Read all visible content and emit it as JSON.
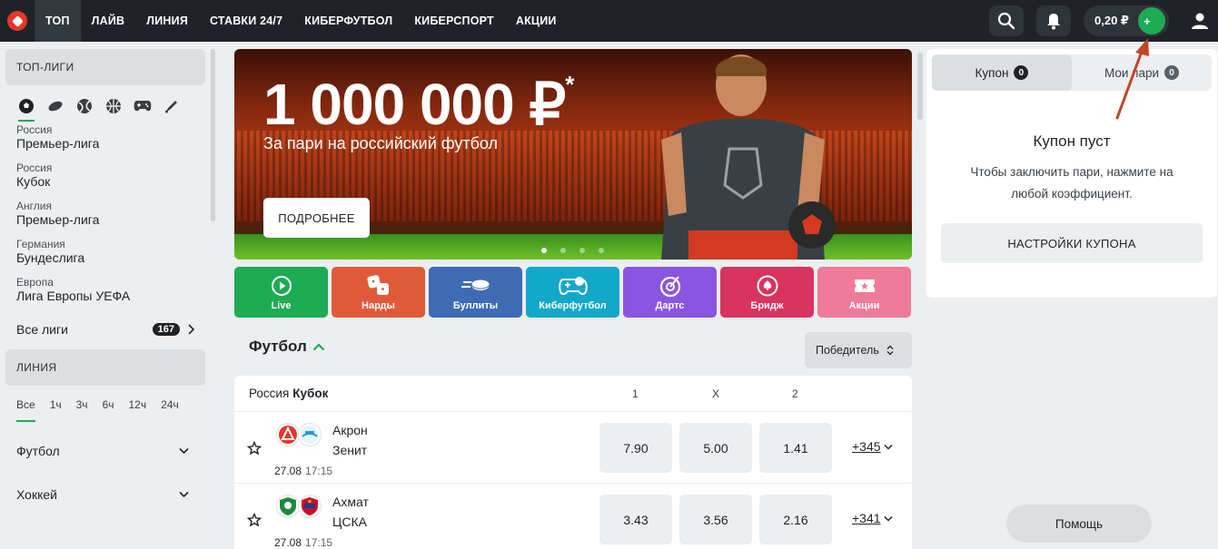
{
  "nav": {
    "items": [
      "ТОП",
      "ЛАЙВ",
      "ЛИНИЯ",
      "СТАВКИ 24/7",
      "КИБЕРФУТБОЛ",
      "КИБЕРСПОРТ",
      "АКЦИИ"
    ],
    "active_index": 0
  },
  "header": {
    "balance": "0,20 ₽",
    "icons": [
      "search-icon",
      "bell-icon",
      "plus-icon",
      "user-icon"
    ]
  },
  "sidebar": {
    "top_leagues_title": "ТОП-ЛИГИ",
    "sport_icons": [
      "football-icon",
      "hockey-icon",
      "tennis-icon",
      "basketball-icon",
      "esports-gamepad-icon",
      "pencil-icon"
    ],
    "leagues": [
      {
        "country": "Россия",
        "name": "Премьер-лига"
      },
      {
        "country": "Россия",
        "name": "Кубок"
      },
      {
        "country": "Англия",
        "name": "Премьер-лига"
      },
      {
        "country": "Германия",
        "name": "Бундеслига"
      },
      {
        "country": "Европа",
        "name": "Лига Европы УЕФА"
      }
    ],
    "all_leagues": {
      "label": "Все лиги",
      "count": "167"
    },
    "line_title": "ЛИНИЯ",
    "time_tabs": [
      "Все",
      "1ч",
      "3ч",
      "6ч",
      "12ч",
      "24ч"
    ],
    "sports": [
      "Футбол",
      "Хоккей"
    ]
  },
  "banner": {
    "amount": "1 000 000 ₽",
    "asterisk": "*",
    "subtitle": "За пари на российский футбол",
    "button": "ПОДРОБНЕЕ",
    "slides": 4,
    "active_slide": 0
  },
  "tiles": [
    {
      "label": "Live",
      "color": "#1faa54",
      "icon": "play-icon"
    },
    {
      "label": "Нарды",
      "color": "#e05a3a",
      "icon": "dice-icon"
    },
    {
      "label": "Буллиты",
      "color": "#3f6bb5",
      "icon": "puck-icon"
    },
    {
      "label": "Киберфутбол",
      "color": "#12a8c9",
      "icon": "gamepad-icon"
    },
    {
      "label": "Дартс",
      "color": "#8a55e0",
      "icon": "darts-icon"
    },
    {
      "label": "Бридж",
      "color": "#d9335f",
      "icon": "spade-icon"
    },
    {
      "label": "Акции",
      "color": "#f07a9a",
      "icon": "ticket-icon"
    }
  ],
  "events": {
    "sport": "Футбол",
    "market_button": "Победитель",
    "league_country": "Россия",
    "league_name": "Кубок",
    "columns": [
      "1",
      "X",
      "2"
    ],
    "matches": [
      {
        "team1": "Акрон",
        "team2": "Зенит",
        "date": "27.08",
        "time": "17:15",
        "odds": [
          "7.90",
          "5.00",
          "1.41"
        ],
        "more": "+345"
      },
      {
        "team1": "Ахмат",
        "team2": "ЦСКА",
        "date": "27.08",
        "time": "17:15",
        "odds": [
          "3.43",
          "3.56",
          "2.16"
        ],
        "more": "+341"
      }
    ]
  },
  "coupon": {
    "tab_coupon": "Купон",
    "tab_coupon_count": "0",
    "tab_my_bets": "Мои пари",
    "tab_my_bets_count": "0",
    "empty_title": "Купон пуст",
    "empty_text": "Чтобы заключить пари, нажмите на любой коэффициент.",
    "settings_button": "НАСТРОЙКИ КУПОНА"
  },
  "help_button": "Помощь",
  "colors": {
    "accent": "#1faa54",
    "topbar": "#1f2327",
    "annotation_arrow": "#c0462a"
  }
}
